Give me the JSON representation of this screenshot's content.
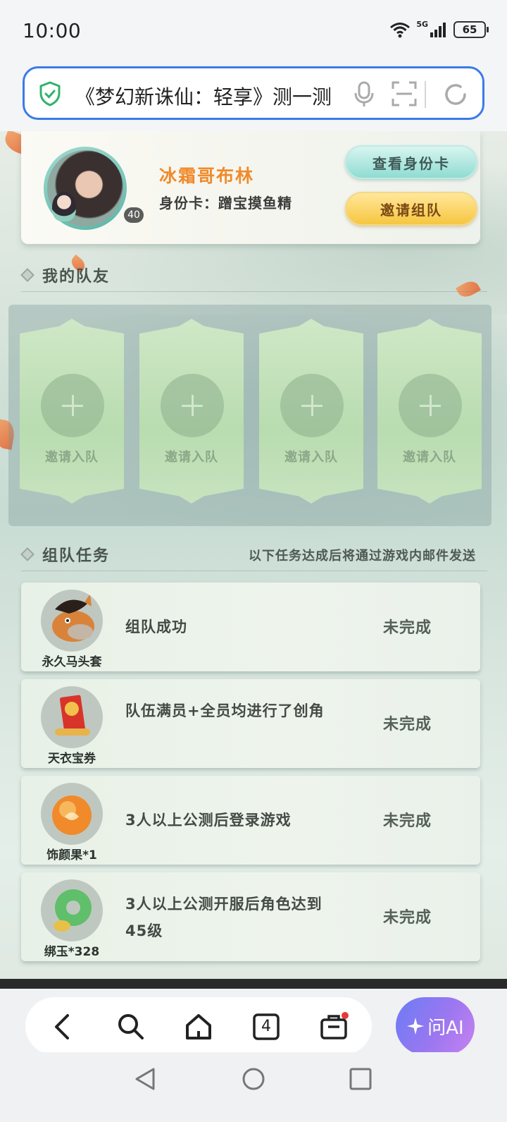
{
  "status": {
    "time": "10:00",
    "network": "5G",
    "battery": "65"
  },
  "urlbar": {
    "text": "《梦幻新诛仙：轻享》测一测"
  },
  "profile": {
    "name": "冰霜哥布林",
    "id_card": "身份卡：蹭宝摸鱼精",
    "level": "40",
    "view_id_label": "查看身份卡",
    "invite_label": "邀请组队"
  },
  "teammates": {
    "title": "我的队友",
    "slots": [
      {
        "label": "邀请入队"
      },
      {
        "label": "邀请入队"
      },
      {
        "label": "邀请入队"
      },
      {
        "label": "邀请入队"
      }
    ]
  },
  "tasks": {
    "title": "组队任务",
    "note": "以下任务达成后将通过游戏内邮件发送",
    "items": [
      {
        "reward": "永久马头套",
        "desc": "组队成功",
        "status": "未完成",
        "icon": "horse-head-icon"
      },
      {
        "reward": "天衣宝券",
        "desc": "队伍满员+全员均进行了创角",
        "status": "未完成",
        "icon": "voucher-icon"
      },
      {
        "reward": "饰颜果*1",
        "desc": "3人以上公测后登录游戏",
        "status": "未完成",
        "icon": "fruit-icon"
      },
      {
        "reward": "绑玉*328",
        "desc": "3人以上公测开服后角色达到45级",
        "status": "未完成",
        "icon": "jade-icon"
      }
    ]
  },
  "browser_nav": {
    "tab_count": "4",
    "ai_label": "问AI"
  },
  "colors": {
    "accent": "#3a7bea",
    "name": "#f08a2a",
    "invite": "#f7c640",
    "idcard": "#8fdcd2"
  }
}
